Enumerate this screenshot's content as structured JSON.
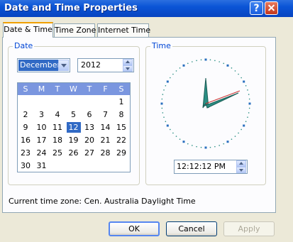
{
  "window": {
    "title": "Date and Time Properties",
    "help_icon_label": "?"
  },
  "tabs": [
    {
      "label": "Date & Time",
      "active": true
    },
    {
      "label": "Time Zone",
      "active": false
    },
    {
      "label": "Internet Time",
      "active": false
    }
  ],
  "date_group": {
    "label": "Date",
    "month": "December",
    "year": "2012",
    "weekdays": [
      "S",
      "M",
      "T",
      "W",
      "T",
      "F",
      "S"
    ],
    "weeks": [
      [
        "",
        "",
        "",
        "",
        "",
        "",
        "1"
      ],
      [
        "2",
        "3",
        "4",
        "5",
        "6",
        "7",
        "8"
      ],
      [
        "9",
        "10",
        "11",
        "12",
        "13",
        "14",
        "15"
      ],
      [
        "16",
        "17",
        "18",
        "19",
        "20",
        "21",
        "22"
      ],
      [
        "23",
        "24",
        "25",
        "26",
        "27",
        "28",
        "29"
      ],
      [
        "30",
        "31",
        "",
        "",
        "",
        "",
        ""
      ]
    ],
    "selected_day": "12"
  },
  "time_group": {
    "label": "Time",
    "time": "12:12:12 PM"
  },
  "current_time_zone": "Current time zone:  Cen. Australia Daylight Time",
  "buttons": {
    "ok": "OK",
    "cancel": "Cancel",
    "apply": "Apply"
  },
  "colors": {
    "title_bar": "#0a54d6",
    "accent": "#316ac5",
    "group_label": "#0046d5",
    "clock_hand": "#2a8f84"
  }
}
